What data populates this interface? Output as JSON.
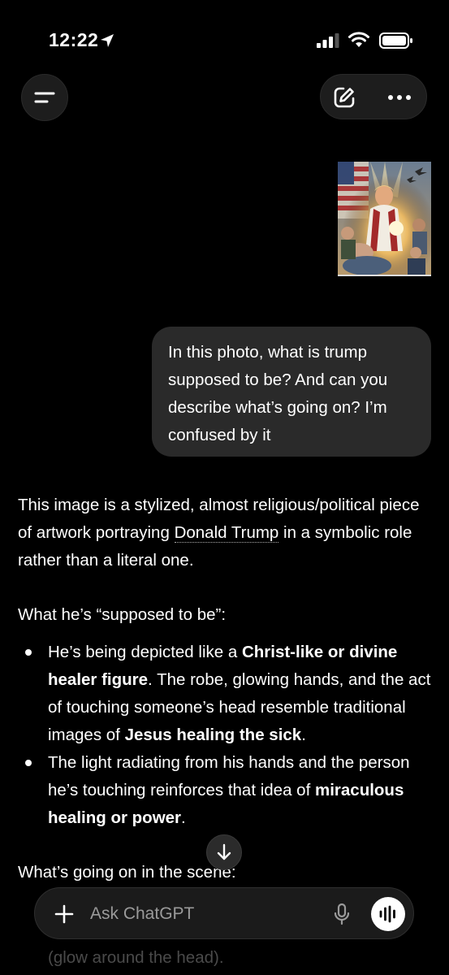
{
  "status_bar": {
    "time": "12:22"
  },
  "user_message": {
    "lines": [
      "In this photo, what is trump",
      "supposed to be? And can you",
      "describe what’s going on? I’m",
      "confused by it"
    ]
  },
  "assistant": {
    "intro": {
      "before_link": "This image is a stylized, almost religious/political piece of artwork portraying ",
      "link": "Donald Trump",
      "after_link": " in a symbolic role rather than a literal one."
    },
    "heading1": "What he’s “supposed to be”:",
    "bullet1": {
      "t1": "He’s being depicted like a ",
      "b1": "Christ-like or divine healer figure",
      "t2": ". The robe, glowing hands, and the act of touching someone’s head resemble traditional images of ",
      "b2": "Jesus healing the sick",
      "t3": "."
    },
    "bullet2": {
      "t1": "The light radiating from his hands and the person he’s touching reinforces that idea of ",
      "b1": "miraculous healing or power",
      "t2": "."
    },
    "heading2": "What’s going on in the scene:",
    "partial_bottom": "(glow around the head)."
  },
  "composer": {
    "placeholder": "Ask ChatGPT"
  },
  "icons": {
    "menu": "menu-icon",
    "edit": "new-chat-edit-icon",
    "more": "more-dots-icon",
    "scroll": "arrow-down-icon",
    "plus": "plus-icon",
    "mic": "microphone-icon",
    "voice": "voice-waveform-icon"
  }
}
